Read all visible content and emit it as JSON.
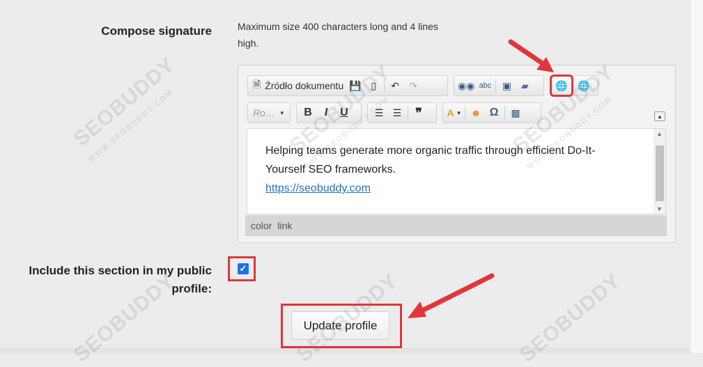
{
  "form": {
    "signature_label": "Compose signature",
    "signature_hint": "Maximum size 400 characters long and 4 lines high.",
    "public_label": "Include this section in my public profile:",
    "public_checked": true,
    "update_button": "Update profile"
  },
  "editor": {
    "source_label": "Źródło dokumentu",
    "font_label": "Ro…",
    "bold": "B",
    "italic": "I",
    "underline": "U",
    "blockquote": "❞",
    "omega": "Ω",
    "content_text": "Helping teams generate more organic traffic through efficient Do-It-Yourself SEO frameworks.",
    "content_link": "https://seobuddy.com",
    "path_items": [
      "color",
      "link"
    ]
  },
  "watermark": {
    "brand": "SEOBUDDY",
    "site": "WWW.SEOBUDDY.COM"
  },
  "colors": {
    "highlight": "#e0363a",
    "link": "#2a6fb8",
    "checkbox": "#1a73e8"
  }
}
